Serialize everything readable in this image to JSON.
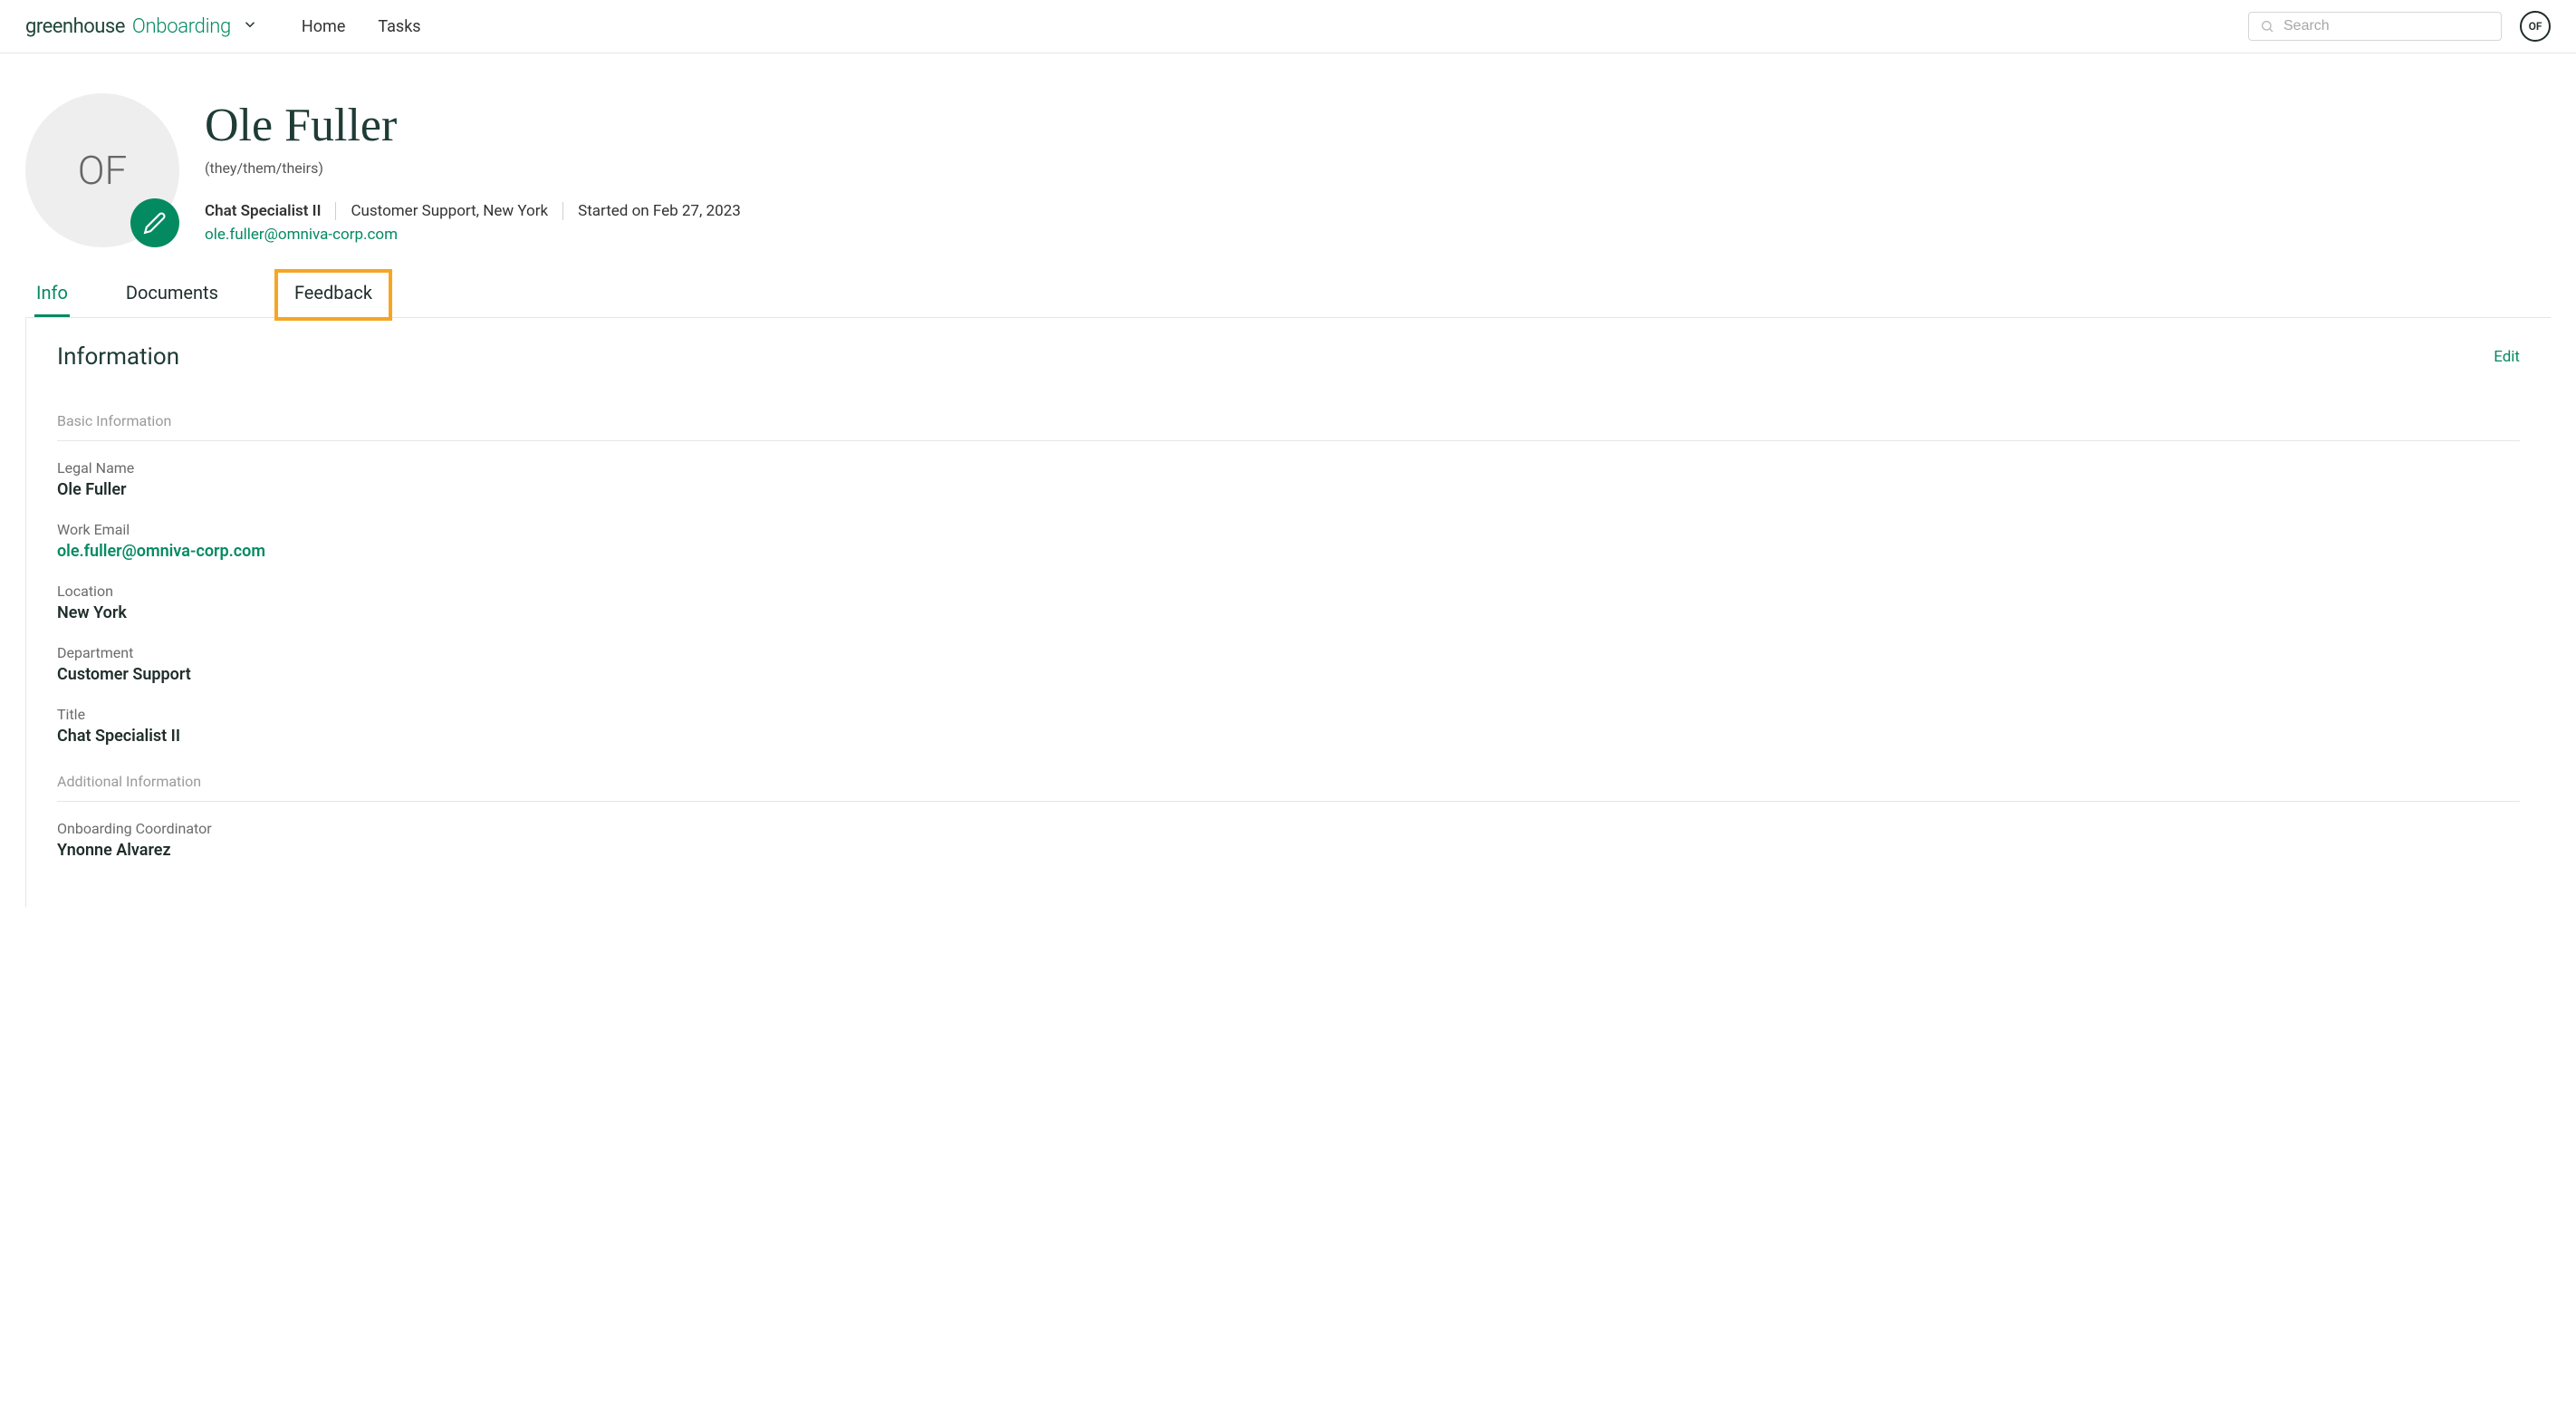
{
  "topbar": {
    "brand_greenhouse": "greenhouse",
    "brand_onboarding": "Onboarding",
    "nav": {
      "home": "Home",
      "tasks": "Tasks"
    },
    "search_placeholder": "Search",
    "avatar_initials": "OF"
  },
  "profile": {
    "avatar_initials": "OF",
    "name": "Ole Fuller",
    "pronouns": "(they/them/theirs)",
    "title": "Chat Specialist II",
    "dept_loc": "Customer Support, New York",
    "start": "Started on Feb 27, 2023",
    "email": "ole.fuller@omniva-corp.com"
  },
  "tabs": {
    "info": "Info",
    "documents": "Documents",
    "feedback": "Feedback"
  },
  "panel": {
    "title": "Information",
    "edit": "Edit",
    "section_basic": "Basic Information",
    "section_additional": "Additional Information",
    "fields": {
      "legal_name": {
        "label": "Legal Name",
        "value": "Ole Fuller"
      },
      "work_email": {
        "label": "Work Email",
        "value": "ole.fuller@omniva-corp.com"
      },
      "location": {
        "label": "Location",
        "value": "New York"
      },
      "department": {
        "label": "Department",
        "value": "Customer Support"
      },
      "title": {
        "label": "Title",
        "value": "Chat Specialist II"
      },
      "coordinator": {
        "label": "Onboarding Coordinator",
        "value": "Ynonne Alvarez"
      }
    }
  }
}
